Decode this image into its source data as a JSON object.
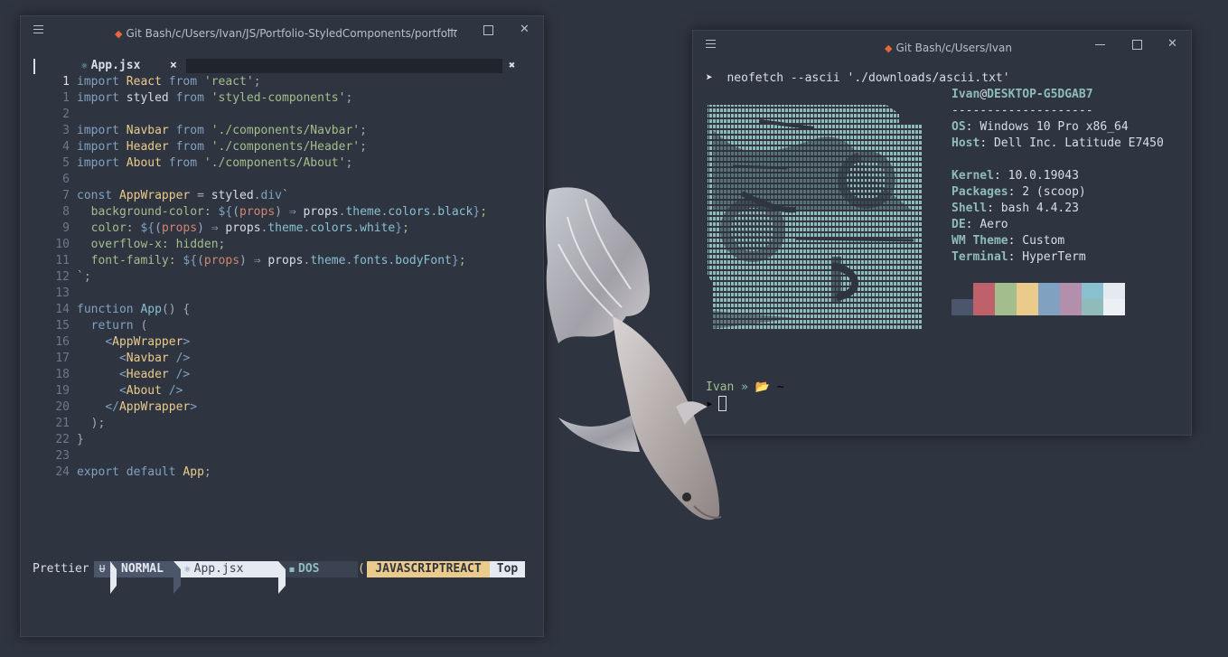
{
  "left_window": {
    "title": "Git Bash/c/Users/Ivan/JS/Portfolio-StyledComponents/portfolio/src",
    "icons": {
      "menu": "hamburger-icon",
      "git": "git-icon",
      "minimize": "minimize-icon",
      "maximize": "maximize-icon",
      "close": "close-icon"
    },
    "tab": {
      "filename": "App.jsx",
      "icon": "react-icon",
      "close": "×",
      "buffer_close": "✖"
    },
    "code_lines": [
      {
        "n": "1",
        "html": "<span class=\"kw\">import</span> <span class=\"id\">React</span> <span class=\"kw\">from</span> <span class=\"str\">'react'</span><span class=\"pu\">;</span>"
      },
      {
        "n": "1",
        "html": "<span class=\"kw\">import</span> styled <span class=\"kw\">from</span> <span class=\"str\">'styled-components'</span><span class=\"pu\">;</span>"
      },
      {
        "n": "2",
        "html": ""
      },
      {
        "n": "3",
        "html": "<span class=\"kw\">import</span> <span class=\"id\">Navbar</span> <span class=\"kw\">from</span> <span class=\"str\">'./components/Navbar'</span><span class=\"pu\">;</span>"
      },
      {
        "n": "4",
        "html": "<span class=\"kw\">import</span> <span class=\"id\">Header</span> <span class=\"kw\">from</span> <span class=\"str\">'./components/Header'</span><span class=\"pu\">;</span>"
      },
      {
        "n": "5",
        "html": "<span class=\"kw\">import</span> <span class=\"id\">About</span> <span class=\"kw\">from</span> <span class=\"str\">'./components/About'</span><span class=\"pu\">;</span>"
      },
      {
        "n": "6",
        "html": ""
      },
      {
        "n": "7",
        "html": "<span class=\"kw\">const</span> <span class=\"id\">AppWrapper</span> <span class=\"pu\">=</span> styled<span class=\"pu\">.</span><span class=\"kw\">div</span><span class=\"str\">`</span>"
      },
      {
        "n": "8",
        "html": "  <span class=\"str\">background-color: </span><span class=\"kw\">${</span><span class=\"pu\">(</span><span class=\"pr\">props</span><span class=\"pu\">)</span> <span class=\"kw\">⇒</span> props<span class=\"pu\">.</span><span class=\"fn\">theme</span><span class=\"pu\">.</span><span class=\"fn\">colors</span><span class=\"pu\">.</span><span class=\"fn\">black</span><span class=\"kw\">}</span><span class=\"str\">;</span>"
      },
      {
        "n": "9",
        "html": "  <span class=\"str\">color: </span><span class=\"kw\">${</span><span class=\"pu\">(</span><span class=\"pr\">props</span><span class=\"pu\">)</span> <span class=\"kw\">⇒</span> props<span class=\"pu\">.</span><span class=\"fn\">theme</span><span class=\"pu\">.</span><span class=\"fn\">colors</span><span class=\"pu\">.</span><span class=\"fn\">white</span><span class=\"kw\">}</span><span class=\"str\">;</span>"
      },
      {
        "n": "10",
        "html": "  <span class=\"str\">overflow-x: hidden;</span>"
      },
      {
        "n": "11",
        "html": "  <span class=\"str\">font-family: </span><span class=\"kw\">${</span><span class=\"pu\">(</span><span class=\"pr\">props</span><span class=\"pu\">)</span> <span class=\"kw\">⇒</span> props<span class=\"pu\">.</span><span class=\"fn\">theme</span><span class=\"pu\">.</span><span class=\"fn\">fonts</span><span class=\"pu\">.</span><span class=\"fn\">bodyFont</span><span class=\"kw\">}</span><span class=\"str\">;</span>"
      },
      {
        "n": "12",
        "html": "<span class=\"str\">`</span><span class=\"pu\">;</span>"
      },
      {
        "n": "13",
        "html": ""
      },
      {
        "n": "14",
        "html": "<span class=\"kw\">function</span> <span class=\"fn\">App</span><span class=\"pu\">()</span> <span class=\"pu\">{</span>"
      },
      {
        "n": "15",
        "html": "  <span class=\"kw\">return</span> <span class=\"pu\">(</span>"
      },
      {
        "n": "16",
        "html": "    <span class=\"tg\">&lt;</span><span class=\"id\">AppWrapper</span><span class=\"tg\">&gt;</span>"
      },
      {
        "n": "17",
        "html": "      <span class=\"tg\">&lt;</span><span class=\"id\">Navbar</span> <span class=\"tg\">/&gt;</span>"
      },
      {
        "n": "18",
        "html": "      <span class=\"tg\">&lt;</span><span class=\"id\">Header</span> <span class=\"tg\">/&gt;</span>"
      },
      {
        "n": "19",
        "html": "      <span class=\"tg\">&lt;</span><span class=\"id\">About</span> <span class=\"tg\">/&gt;</span>"
      },
      {
        "n": "20",
        "html": "    <span class=\"tg\">&lt;/</span><span class=\"id\">AppWrapper</span><span class=\"tg\">&gt;</span>"
      },
      {
        "n": "21",
        "html": "  <span class=\"pu\">);</span>"
      },
      {
        "n": "22",
        "html": "<span class=\"pu\">}</span>"
      },
      {
        "n": "23",
        "html": ""
      },
      {
        "n": "24",
        "html": "<span class=\"kw\">export</span> <span class=\"kw\">default</span> <span class=\"id\">App</span><span class=\"pu\">;</span>"
      }
    ],
    "statusline": {
      "prettier": "Prettier",
      "mode_icon": "vim-icon",
      "mode": "NORMAL",
      "file": "App.jsx",
      "fileformat_icon": "windows-icon",
      "fileformat": "DOS",
      "paren": "(",
      "filetype": "JAVASCRIPTREACT",
      "position": "Top"
    }
  },
  "right_window": {
    "title": "Git Bash/c/Users/Ivan",
    "command": "neofetch --ascii './downloads/ascii.txt'",
    "info": {
      "user": "Ivan",
      "at": "@",
      "host": "DESKTOP-G5DGAB7",
      "separator": "--------------------",
      "rows": [
        {
          "key": "OS",
          "value": "Windows 10 Pro x86_64"
        },
        {
          "key": "Host",
          "value": "Dell Inc. Latitude E7450"
        },
        {
          "key": "",
          "value": ""
        },
        {
          "key": "Kernel",
          "value": "10.0.19043"
        },
        {
          "key": "Packages",
          "value": "2 (scoop)"
        },
        {
          "key": "Shell",
          "value": "bash 4.4.23"
        },
        {
          "key": "DE",
          "value": "Aero"
        },
        {
          "key": "WM Theme",
          "value": "Custom"
        },
        {
          "key": "Terminal",
          "value": "HyperTerm"
        }
      ]
    },
    "palette": {
      "top": [
        "#2e3440",
        "#bf616a",
        "#a3be8c",
        "#ebcb8b",
        "#81a1c1",
        "#b48ead",
        "#88c0d0",
        "#e5e9f0"
      ],
      "bottom": [
        "#4c566a",
        "#bf616a",
        "#a3be8c",
        "#ebcb8b",
        "#81a1c1",
        "#b48ead",
        "#8fbcbb",
        "#eceff4"
      ]
    },
    "prompt": {
      "user": "Ivan",
      "symbol": "»",
      "folder_icon": "folder-icon",
      "dir": "~",
      "arrow": "➤"
    }
  }
}
